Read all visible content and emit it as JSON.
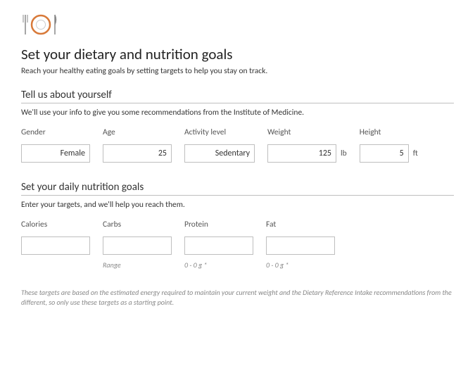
{
  "header": {
    "title": "Set your dietary and nutrition goals",
    "intro": "Reach your healthy eating goals by setting targets to help you stay on track."
  },
  "section1": {
    "heading": "Tell us about yourself",
    "desc": "We'll use your info to give you some recommendations from the Institute of Medicine.",
    "fields": {
      "gender": {
        "label": "Gender",
        "value": "Female"
      },
      "age": {
        "label": "Age",
        "value": "25"
      },
      "activity": {
        "label": "Activity level",
        "value": "Sedentary"
      },
      "weight": {
        "label": "Weight",
        "value": "125",
        "unit": "lb"
      },
      "height": {
        "label": "Height",
        "value": "5",
        "unit": "ft"
      }
    }
  },
  "section2": {
    "heading": "Set your daily nutrition goals",
    "desc": "Enter your targets, and we'll help you reach them.",
    "fields": {
      "calories": {
        "label": "Calories",
        "value": ""
      },
      "carbs": {
        "label": "Carbs",
        "value": "",
        "hint": "Range"
      },
      "protein": {
        "label": "Protein",
        "value": "",
        "hint": "0 - 0 g *"
      },
      "fat": {
        "label": "Fat",
        "value": "",
        "hint": "0 - 0 g *"
      }
    }
  },
  "disclaimer": "These targets are based on the estimated energy required to maintain your current weight and the Dietary Reference Intake recommendations from the different, so only use these targets as a starting point."
}
